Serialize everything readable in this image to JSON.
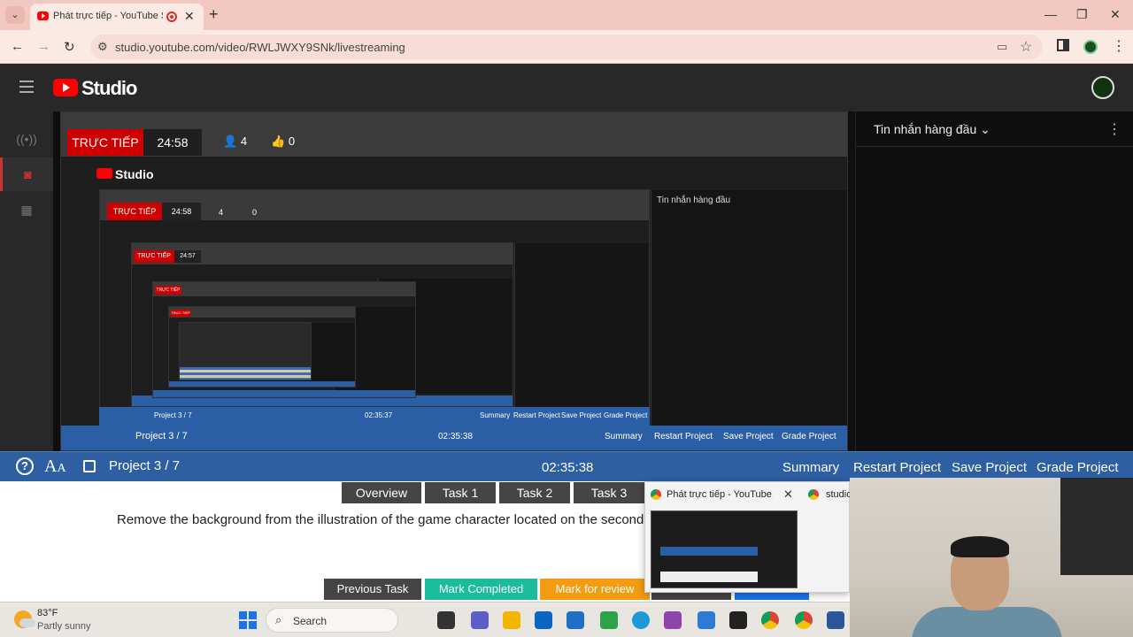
{
  "browser": {
    "tab_title": "Phát trực tiếp - YouTube Studio",
    "url": "studio.youtube.com/video/RWLJWXY9SNk/livestreaming"
  },
  "studio": {
    "logo_text": "Studio"
  },
  "stream": {
    "live_label": "TRỰC TIẾP",
    "timer": "24:58",
    "viewers": "4",
    "likes": "0",
    "nested_live_2": "TRỰC TIẾP",
    "nested_timer_2": "24:58",
    "nested_viewers_2": "4",
    "nested_likes_2": "0",
    "nested_live_3": "TRỰC TIẾP",
    "nested_timer_3": "24:57",
    "nested_live_4": "TRỰC TIẾP",
    "nested_live_5": "TRỰC TIẾP",
    "nested_studio": "Studio",
    "nested_chat": "Tin nhắn hàng đầu",
    "nested_bar_project": "Project 3 / 7",
    "nested_bar_time": "02:35:38",
    "nested_bar_time_2": "02:35:37",
    "nested_bar_summary": "Summary",
    "nested_bar_restart": "Restart Project",
    "nested_bar_save": "Save Project",
    "nested_bar_grade": "Grade Project"
  },
  "chat": {
    "title": "Tin nhắn hàng đầu"
  },
  "exam": {
    "project": "Project 3 / 7",
    "timer": "02:35:38",
    "summary": "Summary",
    "restart": "Restart Project",
    "save": "Save Project",
    "grade": "Grade Project",
    "tabs": [
      "Overview",
      "Task 1",
      "Task 2",
      "Task 3"
    ],
    "task_text": "Remove the background from the illustration of the game character located on the second",
    "buttons": {
      "previous": "Previous Task",
      "completed": "Mark Completed",
      "review": "Mark for review"
    },
    "colors": {
      "bar": "#2e5fa3",
      "completed": "#1abc9c",
      "review": "#f39c12"
    }
  },
  "thumbnail": {
    "title": "Phát trực tiếp - YouTube...",
    "second_title": "studio"
  },
  "taskbar": {
    "temperature": "83°F",
    "condition": "Partly sunny",
    "search": "Search"
  },
  "icons": [
    "search-icon",
    "star-icon",
    "camera-icon",
    "close-icon",
    "help-icon",
    "copy-icon",
    "windows-start-icon"
  ]
}
